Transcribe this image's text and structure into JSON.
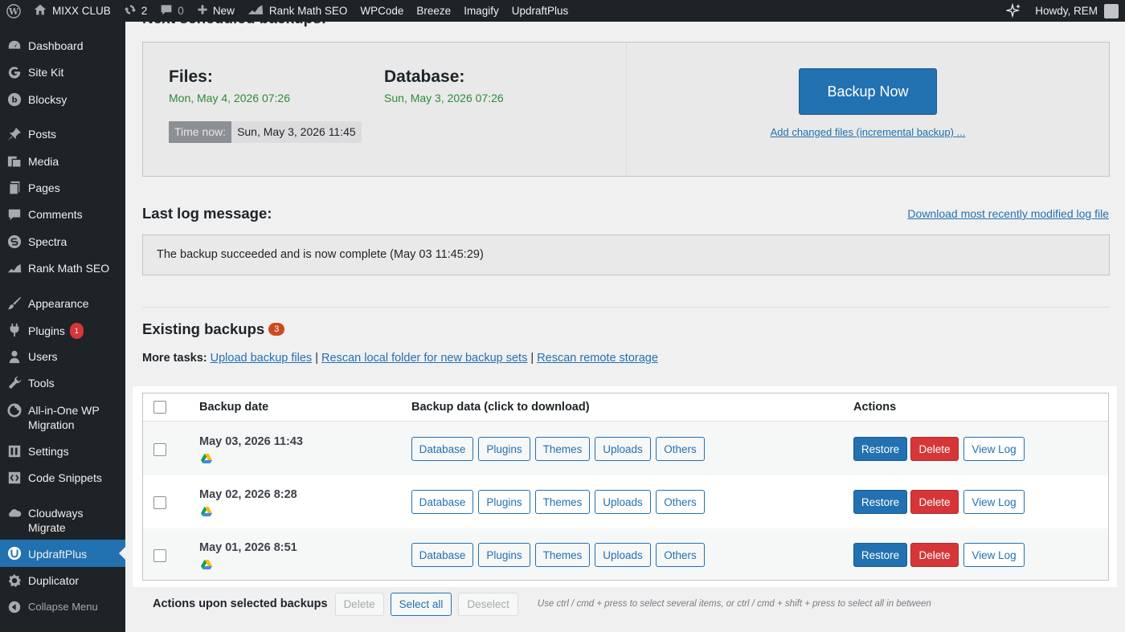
{
  "adminbar": {
    "site_name": "MIXX CLUB",
    "updates_count": "2",
    "comments_count": "0",
    "new_label": "New",
    "items": [
      "Rank Math SEO",
      "WPCode",
      "Breeze",
      "Imagify",
      "UpdraftPlus"
    ],
    "greeting": "Howdy, REM"
  },
  "sidebar": {
    "items": [
      {
        "label": "Dashboard",
        "icon": "dashboard-icon"
      },
      {
        "label": "Site Kit",
        "icon": "google-g-icon"
      },
      {
        "label": "Blocksy",
        "icon": "blocksy-icon"
      },
      {
        "label": "Posts",
        "icon": "pin-icon"
      },
      {
        "label": "Media",
        "icon": "media-icon"
      },
      {
        "label": "Pages",
        "icon": "page-icon"
      },
      {
        "label": "Comments",
        "icon": "comment-icon"
      },
      {
        "label": "Spectra",
        "icon": "spectra-icon"
      },
      {
        "label": "Rank Math SEO",
        "icon": "rankmath-icon"
      },
      {
        "label": "Appearance",
        "icon": "brush-icon"
      },
      {
        "label": "Plugins",
        "icon": "plugin-icon",
        "badge": "1"
      },
      {
        "label": "Users",
        "icon": "users-icon"
      },
      {
        "label": "Tools",
        "icon": "wrench-icon"
      },
      {
        "label": "All-in-One WP Migration",
        "icon": "migration-icon"
      },
      {
        "label": "Settings",
        "icon": "settings-icon"
      },
      {
        "label": "Code Snippets",
        "icon": "code-icon"
      },
      {
        "label": "Cloudways Migrate",
        "icon": "cloud-icon"
      },
      {
        "label": "UpdraftPlus",
        "icon": "updraft-icon",
        "current": true
      },
      {
        "label": "Duplicator",
        "icon": "duplicator-icon"
      },
      {
        "label": "Collapse Menu",
        "icon": "collapse-icon"
      }
    ]
  },
  "schedule": {
    "heading": "Next scheduled backups:",
    "files_label": "Files:",
    "files_date": "Mon, May 4, 2026 07:26",
    "database_label": "Database:",
    "database_date": "Sun, May 3, 2026 07:26",
    "time_now_label": "Time now:",
    "time_now_value": "Sun, May 3, 2026 11:45",
    "backup_now_label": "Backup Now",
    "incremental_link": "Add changed files (incremental backup) ..."
  },
  "log": {
    "heading": "Last log message:",
    "download_link": "Download most recently modified log file",
    "message": "The backup succeeded and is now complete (May 03 11:45:29)"
  },
  "existing": {
    "heading": "Existing backups",
    "count": "3",
    "more_tasks_label": "More tasks:",
    "upload_link": "Upload backup files",
    "rescan_local_link": "Rescan local folder for new backup sets",
    "rescan_remote_link": "Rescan remote storage",
    "separator": "|"
  },
  "table": {
    "col_date": "Backup date",
    "col_data": "Backup data (click to download)",
    "col_actions": "Actions",
    "data_buttons": [
      "Database",
      "Plugins",
      "Themes",
      "Uploads",
      "Others"
    ],
    "action_buttons": {
      "restore": "Restore",
      "delete": "Delete",
      "view_log": "View Log"
    },
    "rows": [
      {
        "date": "May 03, 2026 11:43"
      },
      {
        "date": "May 02, 2026 8:28"
      },
      {
        "date": "May 01, 2026 8:51"
      }
    ]
  },
  "bulk": {
    "label": "Actions upon selected backups",
    "delete": "Delete",
    "select_all": "Select all",
    "deselect": "Deselect",
    "hint": "Use ctrl / cmd + press to select several items, or ctrl / cmd + shift + press to select all in between"
  },
  "colors": {
    "accent": "#2271b1",
    "danger": "#d63638",
    "success_text": "#2e8b37",
    "admin_dark": "#1d2327"
  }
}
